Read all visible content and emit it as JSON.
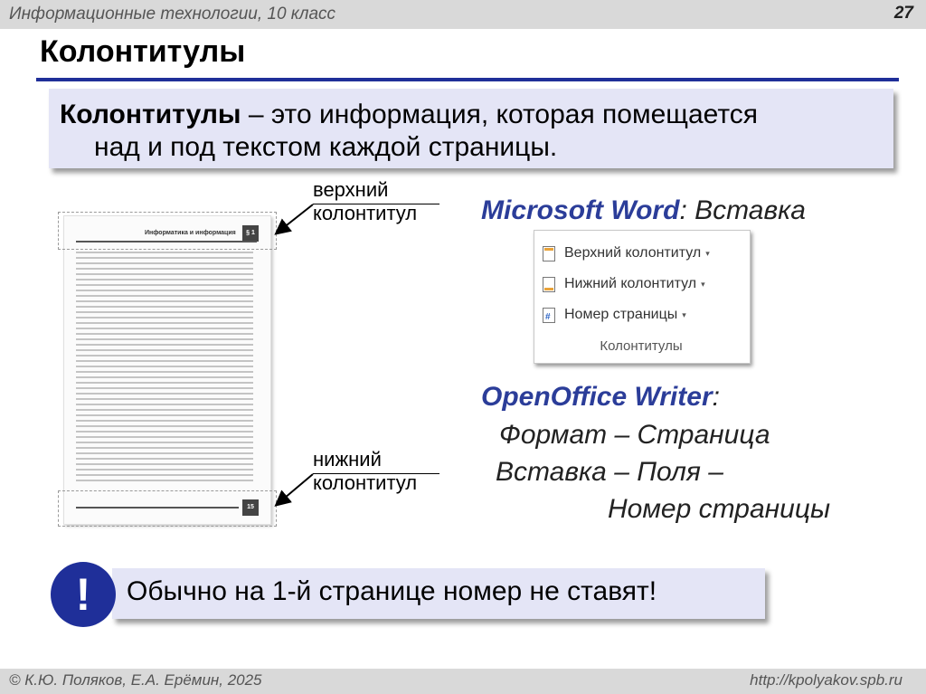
{
  "header": {
    "course": "Информационные технологии, 10 класс",
    "slide_number": "27"
  },
  "title": "Колонтитулы",
  "definition": {
    "term": "Колонтитулы",
    "text_line1": " – это информация, которая помещается",
    "text_line2": "над и под текстом каждой страницы."
  },
  "page_image": {
    "header_title": "Информатика и информация",
    "header_number": "§ 1",
    "footer_number": "15"
  },
  "callouts": {
    "top": [
      "верхний",
      "колонтитул"
    ],
    "bottom": [
      "нижний",
      "колонтитул"
    ]
  },
  "word": {
    "brand": "Microsoft Word",
    "path": ":  Вставка",
    "ribbon": {
      "items": [
        {
          "label": "Верхний колонтитул",
          "icon": "header-doc-icon"
        },
        {
          "label": "Нижний колонтитул",
          "icon": "footer-doc-icon"
        },
        {
          "label": "Номер страницы",
          "icon": "page-number-icon"
        }
      ],
      "group_label": "Колонтитулы"
    }
  },
  "openoffice": {
    "brand": "OpenOffice Writer",
    "colon": ":",
    "lines": [
      "Формат – Страница",
      "Вставка – Поля –",
      "Номер страницы"
    ]
  },
  "note": {
    "mark": "!",
    "text": "Обычно на 1-й странице номер не ставят!"
  },
  "footer": {
    "author": "© К.Ю. Поляков, Е.А. Ерёмин, 2025",
    "url": "http://kpolyakov.spb.ru"
  },
  "colors": {
    "accent": "#1f2f99",
    "box_fill": "#e4e5f6",
    "brand_text": "#2b3d99",
    "bar_gray": "#d9d9d9"
  }
}
